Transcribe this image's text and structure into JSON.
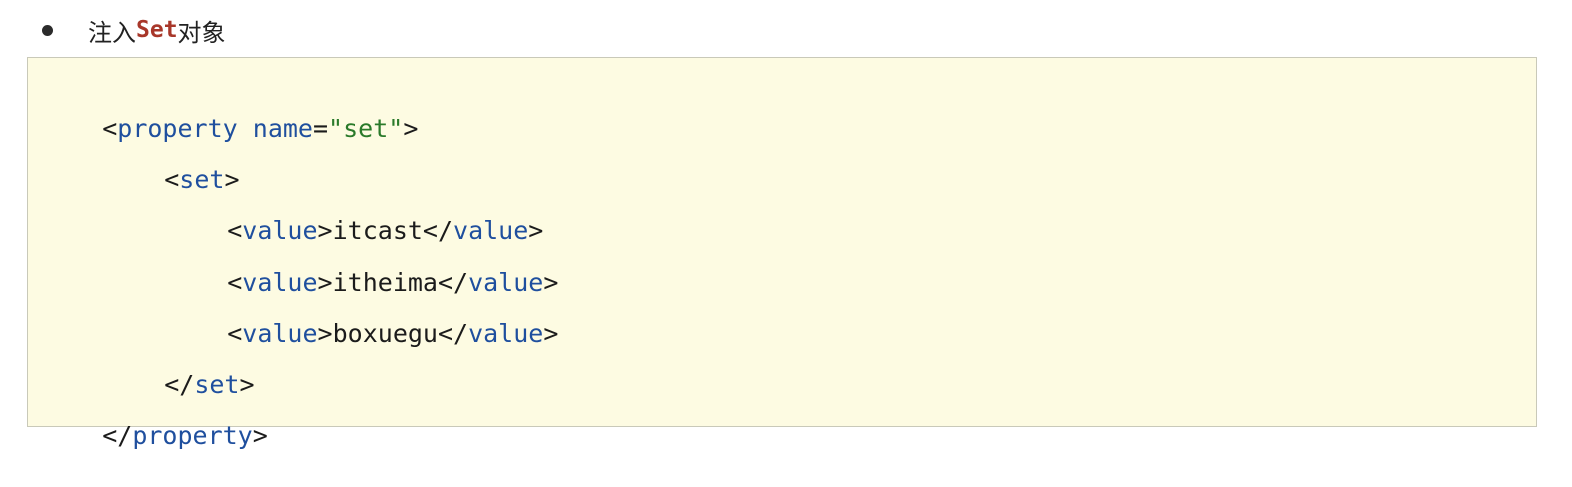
{
  "heading": {
    "prefix": "注入",
    "code_word": "Set",
    "suffix": "对象"
  },
  "code": {
    "line1": {
      "open": "<",
      "tag": "property",
      "space": " ",
      "attr": "name",
      "eq": "=",
      "value": "\"set\"",
      "close": ">"
    },
    "line2": {
      "open": "<",
      "tag": "set",
      "close": ">"
    },
    "line3": {
      "open": "<",
      "tag": "value",
      "close": ">",
      "text": "itcast",
      "end_open": "</",
      "end_tag": "value",
      "end_close": ">"
    },
    "line4": {
      "open": "<",
      "tag": "value",
      "close": ">",
      "text": "itheima",
      "end_open": "</",
      "end_tag": "value",
      "end_close": ">"
    },
    "line5": {
      "open": "<",
      "tag": "value",
      "close": ">",
      "text": "boxuegu",
      "end_open": "</",
      "end_tag": "value",
      "end_close": ">"
    },
    "line6": {
      "open": "</",
      "tag": "set",
      "close": ">"
    },
    "line7": {
      "open": "</",
      "tag": "property",
      "close": ">"
    }
  },
  "colors": {
    "tag": "#1f4f9e",
    "string": "#2a7a2a",
    "heading_code": "#a8372a",
    "code_background": "#fdfbe2"
  }
}
